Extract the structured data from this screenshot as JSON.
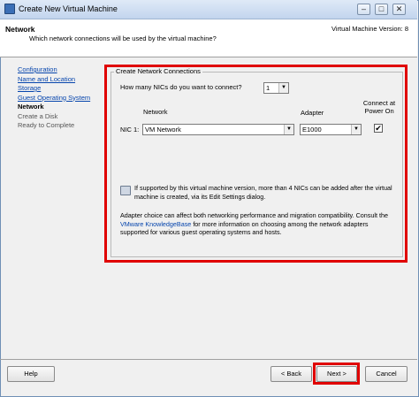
{
  "window": {
    "title": "Create New Virtual Machine",
    "minimize_label": "–",
    "maximize_label": "□",
    "close_label": "✕"
  },
  "header": {
    "title": "Network",
    "subtitle": "Which network connections will be used by the virtual machine?",
    "version": "Virtual Machine Version: 8"
  },
  "nav": {
    "items": [
      {
        "label": "Configuration",
        "state": "completed"
      },
      {
        "label": "Name and Location",
        "state": "completed"
      },
      {
        "label": "Storage",
        "state": "completed"
      },
      {
        "label": "Guest Operating System",
        "state": "completed"
      },
      {
        "label": "Network",
        "state": "current"
      },
      {
        "label": "Create a Disk",
        "state": "pending"
      },
      {
        "label": "Ready to Complete",
        "state": "pending"
      }
    ]
  },
  "network": {
    "group_title": "Create Network Connections",
    "nic_count_label": "How many NICs do you want to connect?",
    "nic_count_value": "1",
    "col_network": "Network",
    "col_adapter": "Adapter",
    "col_connect": "Connect at Power On",
    "nic_label": "NIC 1:",
    "nic_network": "VM Network",
    "nic_adapter": "E1000",
    "connect_checked": "✔",
    "info_text": "If supported by this virtual machine version, more than 4 NICs can be added after the virtual machine is created, via its Edit Settings dialog.",
    "adapter_text_before": "Adapter choice can affect both networking performance and migration compatibility. Consult the",
    "adapter_link": "VMware KnowledgeBase",
    "adapter_text_after": "for more information on choosing among the network adapters supported for various guest operating systems and hosts."
  },
  "footer": {
    "help": "Help",
    "back": "< Back",
    "next": "Next >",
    "cancel": "Cancel"
  },
  "colors": {
    "highlight": "#e00000",
    "link": "#0645ad"
  }
}
